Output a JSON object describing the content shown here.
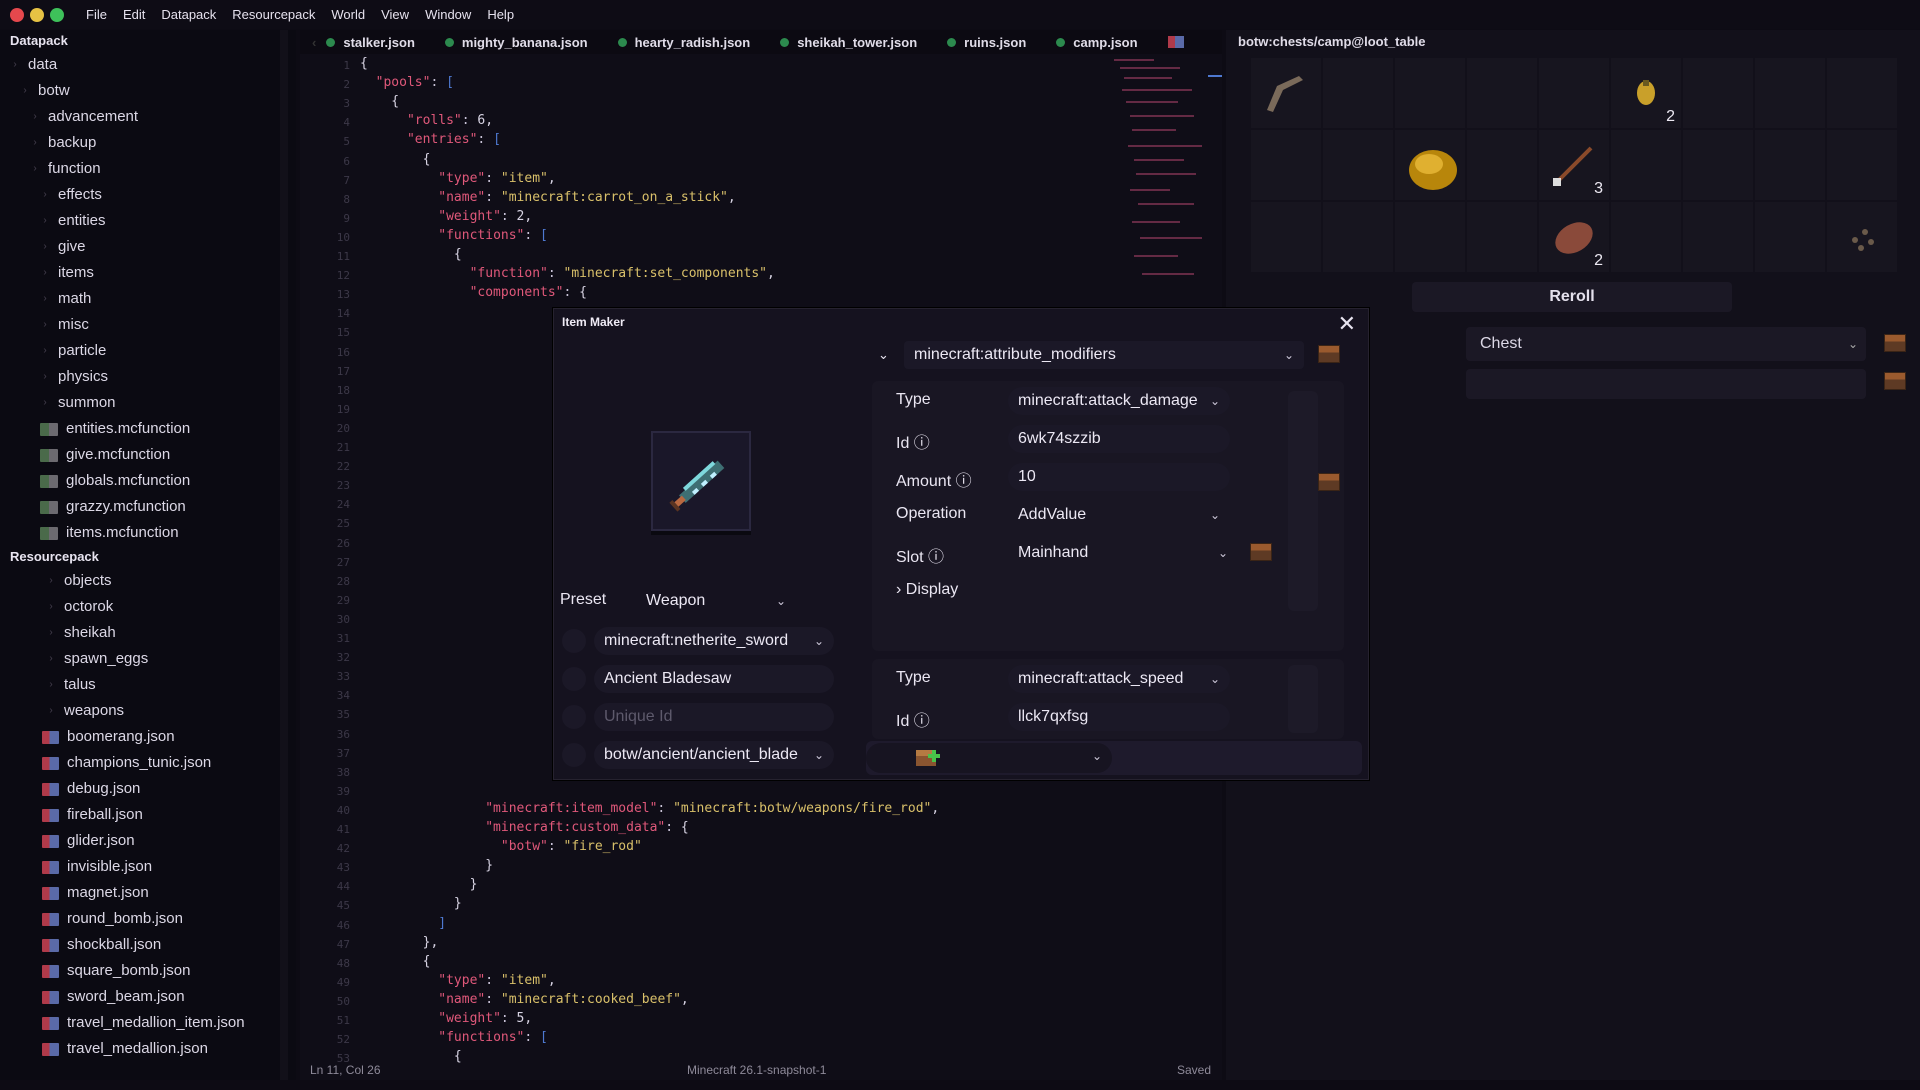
{
  "menu": [
    "File",
    "Edit",
    "Datapack",
    "Resourcepack",
    "World",
    "View",
    "Window",
    "Help"
  ],
  "window_dots": [
    "#e5484d",
    "#e6c244",
    "#3ec15a"
  ],
  "sidebar": {
    "datapack_header": "Datapack",
    "datapack_items": [
      {
        "label": "data",
        "indent": 0,
        "type": "folder"
      },
      {
        "label": "botw",
        "indent": 1,
        "type": "folder"
      },
      {
        "label": "advancement",
        "indent": 2,
        "type": "folder"
      },
      {
        "label": "backup",
        "indent": 2,
        "type": "folder"
      },
      {
        "label": "function",
        "indent": 2,
        "type": "folder"
      },
      {
        "label": "effects",
        "indent": 3,
        "type": "folder"
      },
      {
        "label": "entities",
        "indent": 3,
        "type": "folder"
      },
      {
        "label": "give",
        "indent": 3,
        "type": "folder"
      },
      {
        "label": "items",
        "indent": 3,
        "type": "folder"
      },
      {
        "label": "math",
        "indent": 3,
        "type": "folder"
      },
      {
        "label": "misc",
        "indent": 3,
        "type": "folder"
      },
      {
        "label": "particle",
        "indent": 3,
        "type": "folder"
      },
      {
        "label": "physics",
        "indent": 3,
        "type": "folder"
      },
      {
        "label": "summon",
        "indent": 3,
        "type": "folder"
      },
      {
        "label": "entities.mcfunction",
        "indent": 3,
        "type": "mcfunction"
      },
      {
        "label": "give.mcfunction",
        "indent": 3,
        "type": "mcfunction"
      },
      {
        "label": "globals.mcfunction",
        "indent": 3,
        "type": "mcfunction"
      },
      {
        "label": "grazzy.mcfunction",
        "indent": 3,
        "type": "mcfunction"
      },
      {
        "label": "items.mcfunction",
        "indent": 3,
        "type": "mcfunction"
      }
    ],
    "resourcepack_header": "Resourcepack",
    "resourcepack_items": [
      {
        "label": "objects",
        "type": "folder"
      },
      {
        "label": "octorok",
        "type": "folder"
      },
      {
        "label": "sheikah",
        "type": "folder"
      },
      {
        "label": "spawn_eggs",
        "type": "folder"
      },
      {
        "label": "talus",
        "type": "folder"
      },
      {
        "label": "weapons",
        "type": "folder"
      },
      {
        "label": "boomerang.json",
        "type": "json"
      },
      {
        "label": "champions_tunic.json",
        "type": "json"
      },
      {
        "label": "debug.json",
        "type": "json"
      },
      {
        "label": "fireball.json",
        "type": "json"
      },
      {
        "label": "glider.json",
        "type": "json"
      },
      {
        "label": "invisible.json",
        "type": "json"
      },
      {
        "label": "magnet.json",
        "type": "json"
      },
      {
        "label": "round_bomb.json",
        "type": "json"
      },
      {
        "label": "shockball.json",
        "type": "json"
      },
      {
        "label": "square_bomb.json",
        "type": "json"
      },
      {
        "label": "sword_beam.json",
        "type": "json"
      },
      {
        "label": "travel_medallion_item.json",
        "type": "json"
      },
      {
        "label": "travel_medallion.json",
        "type": "json"
      }
    ]
  },
  "tabs": [
    "stalker.json",
    "mighty_banana.json",
    "hearty_radish.json",
    "sheikah_tower.json",
    "ruins.json",
    "camp.json"
  ],
  "code_lines": [
    {
      "n": 1,
      "t": "{",
      "i": 0
    },
    {
      "n": 2,
      "t": "  \"pools\": [",
      "i": 0
    },
    {
      "n": 3,
      "t": "    {",
      "i": 0
    },
    {
      "n": 4,
      "t": "      \"rolls\": 6,",
      "i": 0
    },
    {
      "n": 5,
      "t": "      \"entries\": [",
      "i": 0
    },
    {
      "n": 6,
      "t": "        {",
      "i": 0
    },
    {
      "n": 7,
      "t": "          \"type\": \"item\",",
      "i": 0
    },
    {
      "n": 8,
      "t": "          \"name\": \"minecraft:carrot_on_a_stick\",",
      "i": 0
    },
    {
      "n": 9,
      "t": "          \"weight\": 2,",
      "i": 0
    },
    {
      "n": 10,
      "t": "          \"functions\": [",
      "i": 0
    },
    {
      "n": 11,
      "t": "            {",
      "i": 0
    },
    {
      "n": 12,
      "t": "              \"function\": \"minecraft:set_components\",",
      "i": 0
    },
    {
      "n": 13,
      "t": "              \"components\": {",
      "i": 0
    }
  ],
  "code_lines_lower": [
    {
      "n": 40,
      "t": "                \"minecraft:item_model\": \"minecraft:botw/weapons/fire_rod\","
    },
    {
      "n": 41,
      "t": "                \"minecraft:custom_data\": {"
    },
    {
      "n": 42,
      "t": "                  \"botw\": \"fire_rod\""
    },
    {
      "n": 43,
      "t": "                }"
    },
    {
      "n": 44,
      "t": "              }"
    },
    {
      "n": 45,
      "t": "            }"
    },
    {
      "n": 46,
      "t": "          ]"
    },
    {
      "n": 47,
      "t": "        },"
    },
    {
      "n": 48,
      "t": "        {"
    },
    {
      "n": 49,
      "t": "          \"type\": \"item\","
    },
    {
      "n": 50,
      "t": "          \"name\": \"minecraft:cooked_beef\","
    },
    {
      "n": 51,
      "t": "          \"weight\": 5,"
    },
    {
      "n": 52,
      "t": "          \"functions\": ["
    },
    {
      "n": 53,
      "t": "            {"
    }
  ],
  "status": {
    "position": "Ln 11, Col 26",
    "version": "Minecraft 26.1-snapshot-1",
    "saved": "Saved"
  },
  "loot": {
    "title": "botw:chests/camp@loot_table",
    "reroll": "Reroll",
    "chest_select": "Chest",
    "slots": [
      {
        "item": "boomerang",
        "count": ""
      },
      {
        "item": "",
        "count": ""
      },
      {
        "item": "",
        "count": ""
      },
      {
        "item": "",
        "count": ""
      },
      {
        "item": "",
        "count": ""
      },
      {
        "item": "seed",
        "count": "2"
      },
      {
        "item": "",
        "count": ""
      },
      {
        "item": "",
        "count": ""
      },
      {
        "item": "",
        "count": ""
      },
      {
        "item": "",
        "count": ""
      },
      {
        "item": "",
        "count": ""
      },
      {
        "item": "gold-ore",
        "count": ""
      },
      {
        "item": "",
        "count": ""
      },
      {
        "item": "arrow",
        "count": "3"
      },
      {
        "item": "",
        "count": ""
      },
      {
        "item": "",
        "count": ""
      },
      {
        "item": "",
        "count": ""
      },
      {
        "item": "",
        "count": ""
      },
      {
        "item": "",
        "count": ""
      },
      {
        "item": "",
        "count": ""
      },
      {
        "item": "",
        "count": ""
      },
      {
        "item": "",
        "count": ""
      },
      {
        "item": "meat",
        "count": "2"
      },
      {
        "item": "",
        "count": ""
      },
      {
        "item": "",
        "count": ""
      },
      {
        "item": "",
        "count": ""
      },
      {
        "item": "seeds",
        "count": ""
      }
    ]
  },
  "modal": {
    "title": "Item Maker",
    "preset_label": "Preset",
    "preset_value": "Weapon",
    "base_item": "minecraft:netherite_sword",
    "item_name": "Ancient Bladesaw",
    "unique_id_placeholder": "Unique Id",
    "model": "botw/ancient/ancient_blade",
    "component": "minecraft:attribute_modifiers",
    "modifier1": {
      "type_label": "Type",
      "type_value": "minecraft:attack_damage",
      "id_label": "Id",
      "id_value": "6wk74szzib",
      "amount_label": "Amount",
      "amount_value": "10",
      "operation_label": "Operation",
      "operation_value": "AddValue",
      "slot_label": "Slot",
      "slot_value": "Mainhand",
      "display_label": "Display"
    },
    "modifier2": {
      "type_label": "Type",
      "type_value": "minecraft:attack_speed",
      "id_label": "Id",
      "id_value": "llck7qxfsg"
    }
  }
}
